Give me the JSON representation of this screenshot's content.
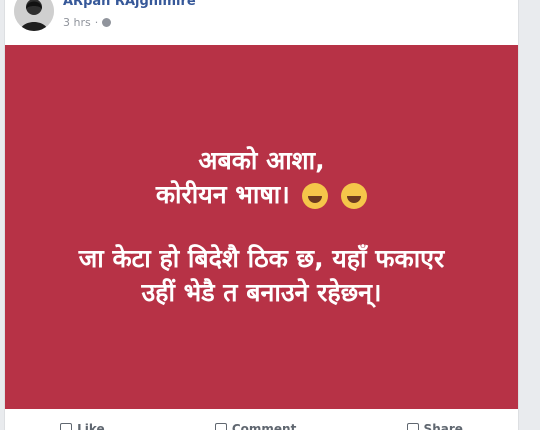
{
  "post": {
    "author": "ARpan RAjghimire",
    "timestamp": "3 hrs",
    "privacy_separator": "·",
    "icons": {
      "avatar": "profile-photo",
      "privacy": "globe-icon"
    },
    "image_text": {
      "line1": "अबको आशा,",
      "line2": "कोरीयन भाषा।",
      "line3": "जा केटा हो बिदेशै ठिक छ, यहाँ फकाएर",
      "line4": "उहीं भेडै त बनाउने रहेछन्।"
    },
    "image_background": "#b73246",
    "actions": {
      "like": "Like",
      "comment": "Comment",
      "share": "Share"
    }
  }
}
